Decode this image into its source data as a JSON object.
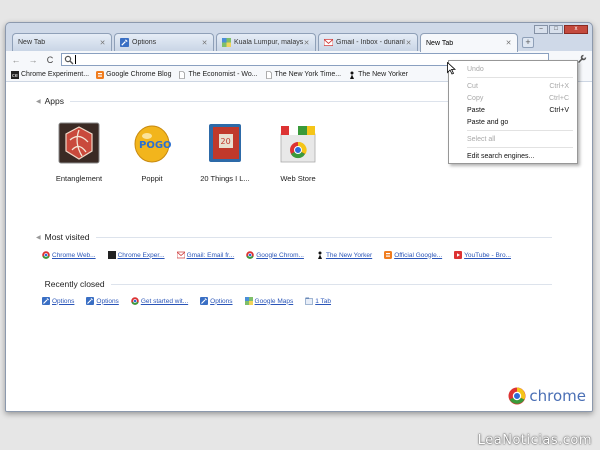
{
  "tabs": [
    {
      "label": "New Tab",
      "icon": "blank-page-icon"
    },
    {
      "label": "Options",
      "icon": "wrench-icon"
    },
    {
      "label": "Kuala Lumpur, malaysi...",
      "icon": "google-maps-icon"
    },
    {
      "label": "Gmail - Inbox - durianl...",
      "icon": "gmail-icon"
    },
    {
      "label": "New Tab",
      "icon": "blank-page-icon",
      "active": true
    }
  ],
  "window_controls": {
    "minimize": "–",
    "maximize": "□",
    "close": "x"
  },
  "toolbar": {
    "back": "←",
    "forward": "→",
    "reload": "C",
    "omnibox_value": "",
    "wrench": "🔧"
  },
  "bookmarks": [
    {
      "label": "Chrome Experiment...",
      "icon": "chrome-experiments-icon"
    },
    {
      "label": "Google Chrome Blog",
      "icon": "blogger-icon"
    },
    {
      "label": "The Economist - Wo...",
      "icon": "page-icon"
    },
    {
      "label": "The New York Time...",
      "icon": "page-icon"
    },
    {
      "label": "The New Yorker",
      "icon": "new-yorker-icon"
    }
  ],
  "sections": {
    "apps": "Apps",
    "most_visited": "Most visited",
    "recently_closed": "Recently closed"
  },
  "apps": [
    {
      "label": "Entanglement",
      "icon": "entanglement-icon"
    },
    {
      "label": "Poppit",
      "icon": "poppit-icon"
    },
    {
      "label": "20 Things I L...",
      "icon": "20-things-book-icon",
      "badge": "20"
    },
    {
      "label": "Web Store",
      "icon": "web-store-icon"
    }
  ],
  "apps_poppit_logo": "POGO",
  "most_visited": [
    {
      "label": "Chrome Web...",
      "icon": "chrome-icon"
    },
    {
      "label": "Chrome Exper...",
      "icon": "chrome-experiments-icon"
    },
    {
      "label": "Gmail: Email fr...",
      "icon": "gmail-icon"
    },
    {
      "label": "Google Chrom...",
      "icon": "chrome-icon"
    },
    {
      "label": "The New Yorker",
      "icon": "new-yorker-icon"
    },
    {
      "label": "Official Google...",
      "icon": "blogger-icon"
    },
    {
      "label": "YouTube - Bro...",
      "icon": "youtube-icon"
    }
  ],
  "recently_closed": [
    {
      "label": "Options",
      "icon": "wrench-icon"
    },
    {
      "label": "Options",
      "icon": "wrench-icon"
    },
    {
      "label": "Get started wit...",
      "icon": "chrome-icon"
    },
    {
      "label": "Options",
      "icon": "wrench-icon"
    },
    {
      "label": "Google Maps",
      "icon": "google-maps-icon"
    },
    {
      "label": "1 Tab",
      "icon": "tab-icon"
    }
  ],
  "context_menu": {
    "items": [
      {
        "label": "Undo",
        "shortcut": "",
        "enabled": false
      },
      {
        "sep": true
      },
      {
        "label": "Cut",
        "shortcut": "Ctrl+X",
        "enabled": false
      },
      {
        "label": "Copy",
        "shortcut": "Ctrl+C",
        "enabled": false
      },
      {
        "label": "Paste",
        "shortcut": "Ctrl+V",
        "enabled": true
      },
      {
        "label": "Paste and go",
        "shortcut": "",
        "enabled": true
      },
      {
        "sep": true
      },
      {
        "label": "Select all",
        "shortcut": "",
        "enabled": false
      },
      {
        "sep": true
      },
      {
        "label": "Edit search engines...",
        "shortcut": "",
        "enabled": true
      }
    ]
  },
  "branding": {
    "chrome_label": "chrome"
  },
  "watermark": "LeaNoticias.com",
  "colors": {
    "link": "#2a55b8",
    "window_frame": "#cfd9e8",
    "chrome_blue": "#4a6fb5"
  }
}
